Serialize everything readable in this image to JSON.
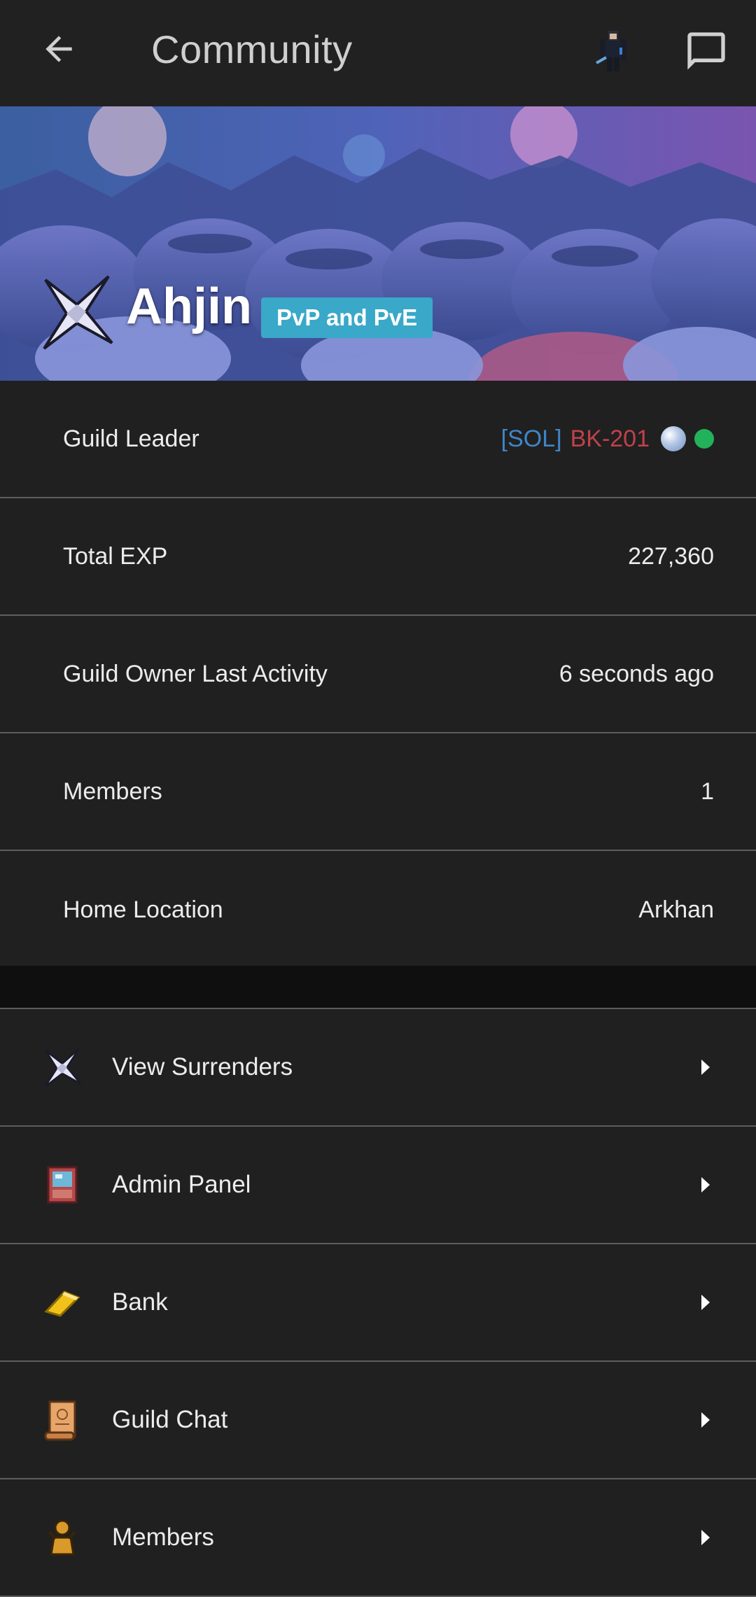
{
  "header": {
    "title": "Community",
    "back_icon": "arrow-left-icon",
    "avatar_icon": "player-avatar",
    "message_icon": "chat-bubble-icon"
  },
  "banner": {
    "guild_name": "Ahjin",
    "tag": "PvP and PvE",
    "logo_icon": "guild-crest-icon"
  },
  "info": {
    "leader": {
      "label": "Guild Leader",
      "prefix": "[SOL]",
      "name": "BK-201"
    },
    "exp": {
      "label": "Total EXP",
      "value": "227,360"
    },
    "activity": {
      "label": "Guild Owner Last Activity",
      "value": "6 seconds ago"
    },
    "members": {
      "label": "Members",
      "value": "1"
    },
    "home": {
      "label": "Home Location",
      "value": "Arkhan"
    }
  },
  "menu": [
    {
      "label": "View Surrenders",
      "icon": "white-flag-icon"
    },
    {
      "label": "Admin Panel",
      "icon": "admin-panel-icon"
    },
    {
      "label": "Bank",
      "icon": "gold-bar-icon"
    },
    {
      "label": "Guild Chat",
      "icon": "scroll-icon"
    },
    {
      "label": "Members",
      "icon": "members-icon"
    }
  ],
  "colors": {
    "prefix": "#3f86c8",
    "leader_name": "#c0414a",
    "tag_bg": "#3aa8c8",
    "online": "#22b35a"
  }
}
